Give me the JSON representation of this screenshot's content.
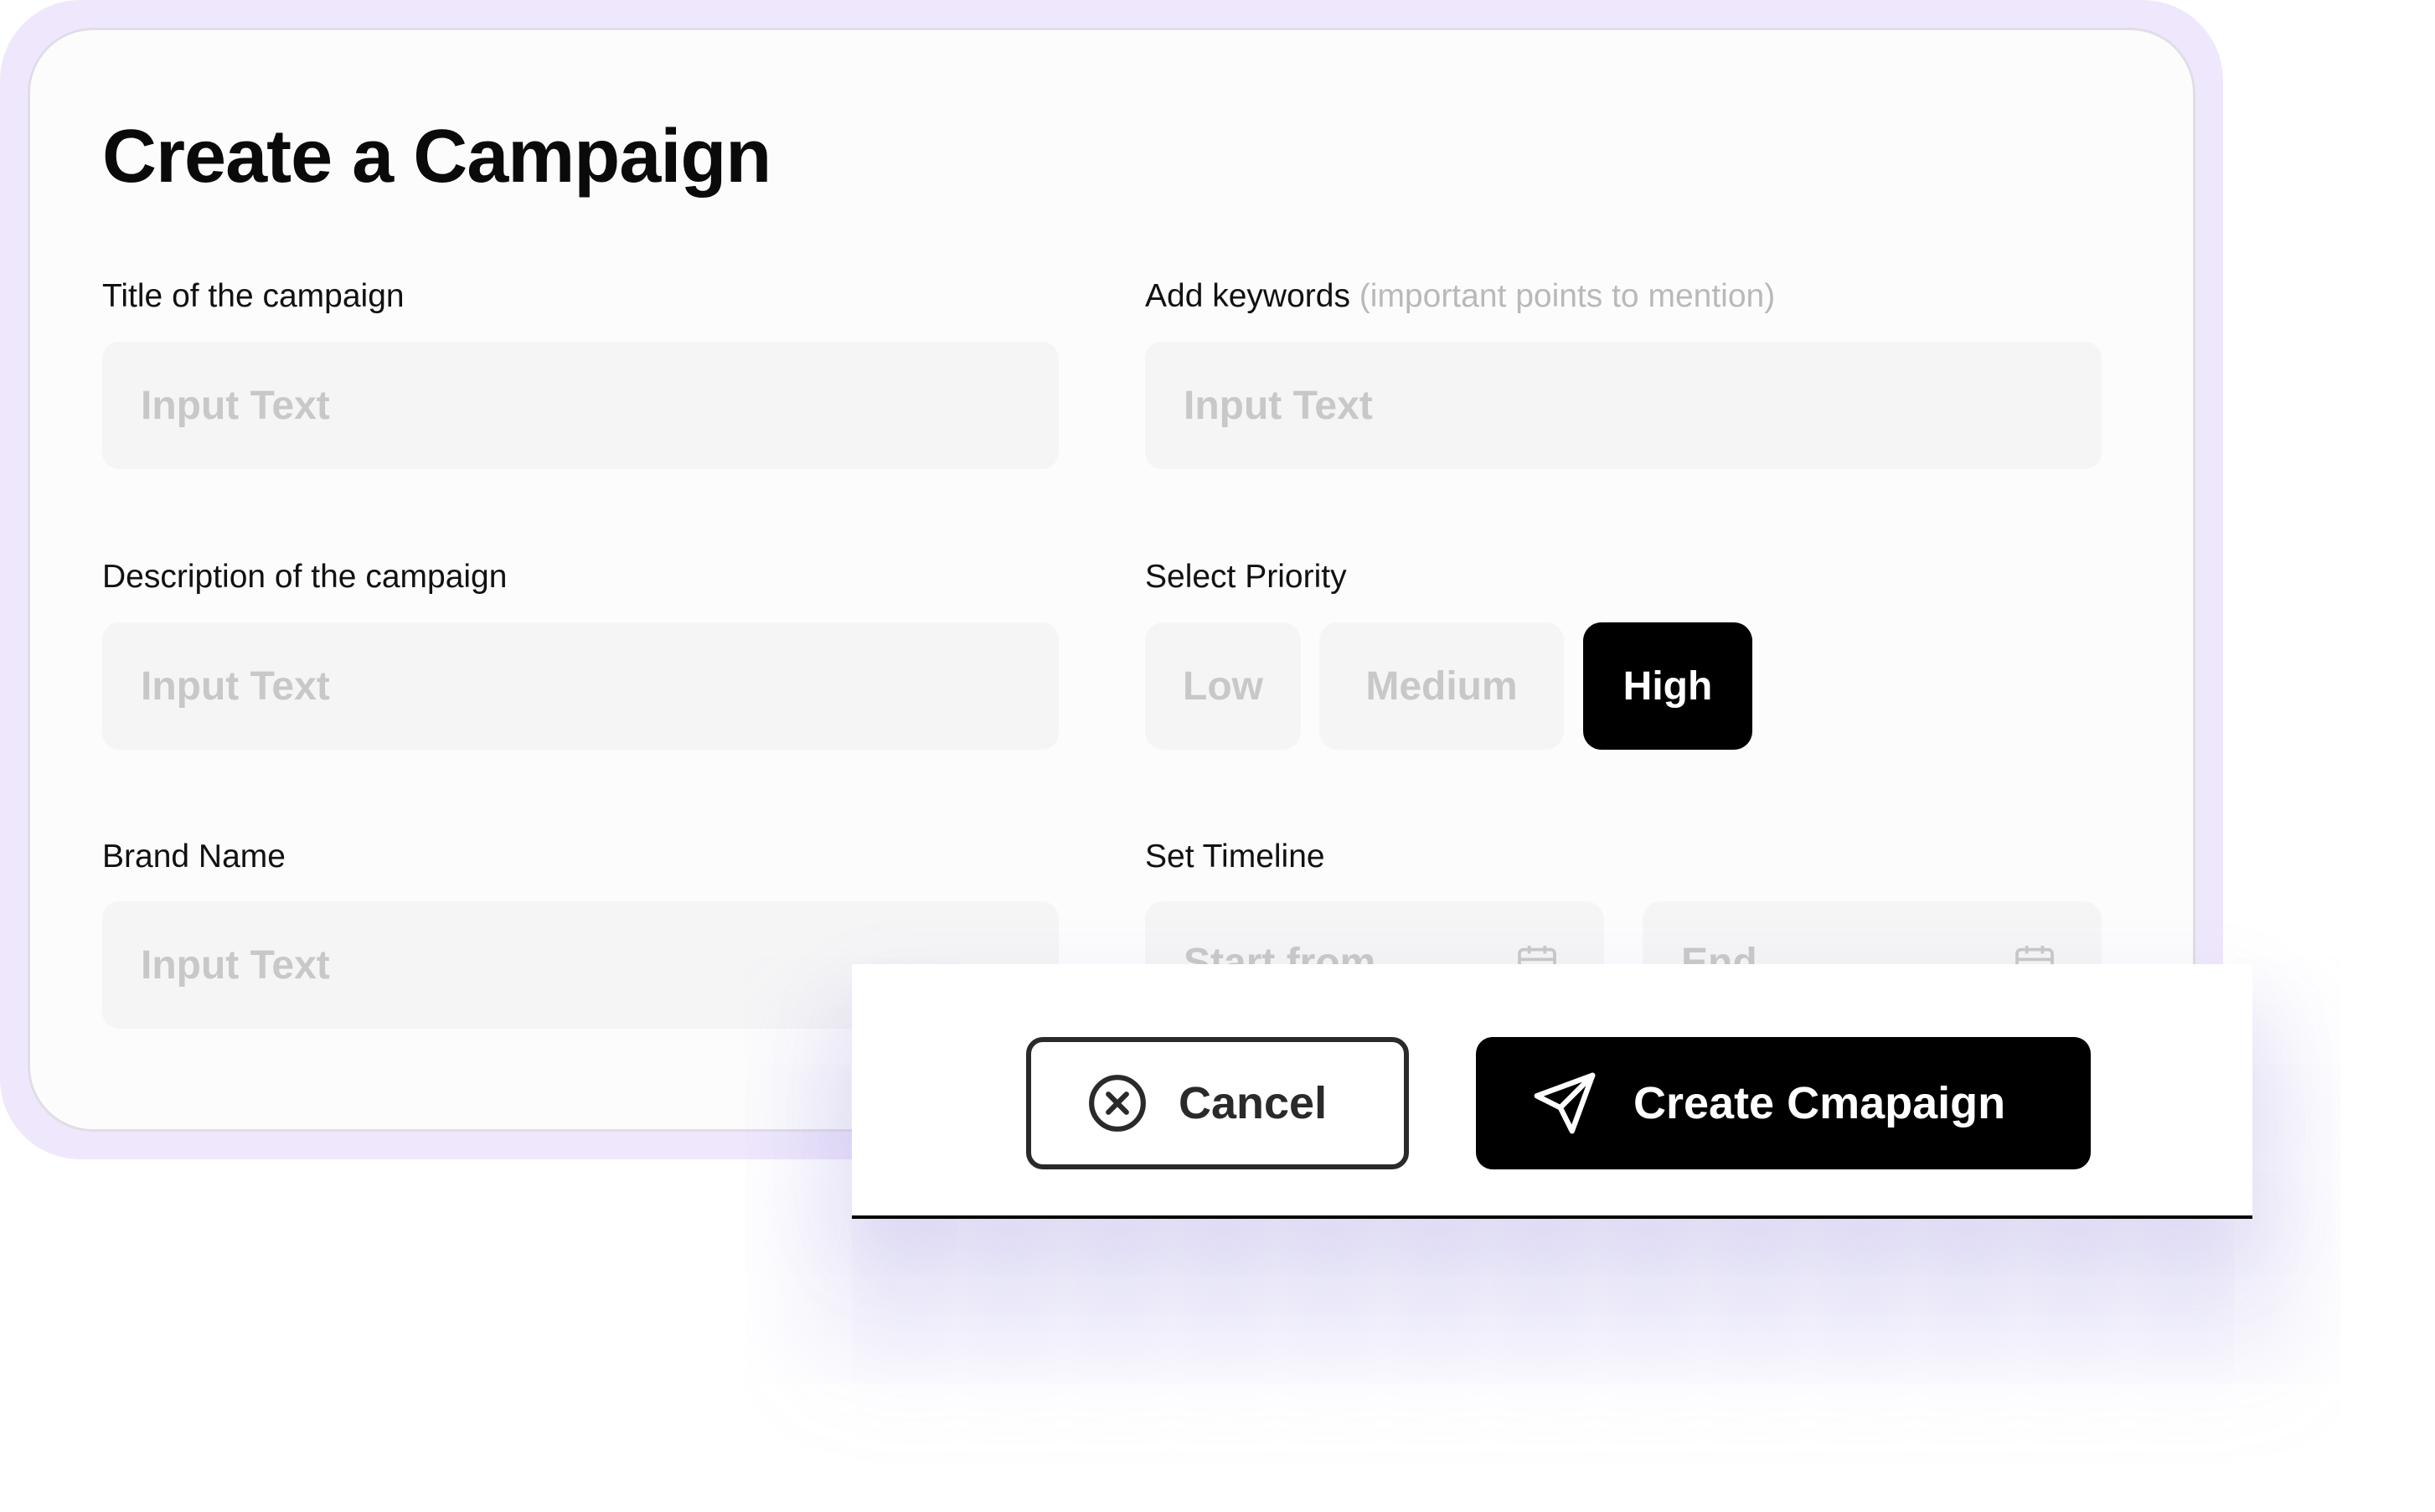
{
  "title": "Create a Campaign",
  "fields": {
    "campaign_title": {
      "label": "Title of the campaign",
      "placeholder": "Input Text",
      "value": ""
    },
    "keywords": {
      "label": "Add keywords",
      "hint": "(important points to mention)",
      "placeholder": "Input Text",
      "value": ""
    },
    "description": {
      "label": "Description of the campaign",
      "placeholder": "Input Text",
      "value": ""
    },
    "brand_name": {
      "label": "Brand Name",
      "placeholder": "Input Text",
      "value": ""
    }
  },
  "priority": {
    "label": "Select Priority",
    "options": [
      "Low",
      "Medium",
      "High"
    ],
    "selected": "High"
  },
  "timeline": {
    "label": "Set Timeline",
    "start_placeholder": "Start from",
    "end_placeholder": "End",
    "icon": "calendar-icon"
  },
  "actions": {
    "cancel_label": "Cancel",
    "cancel_icon": "close-circle-icon",
    "create_label": "Create Cmapaign",
    "create_icon": "send-icon"
  },
  "colors": {
    "frame": "#efe8fc",
    "primary": "#000000",
    "placeholder": "#c8c8c8",
    "input_bg": "#f5f5f6"
  }
}
